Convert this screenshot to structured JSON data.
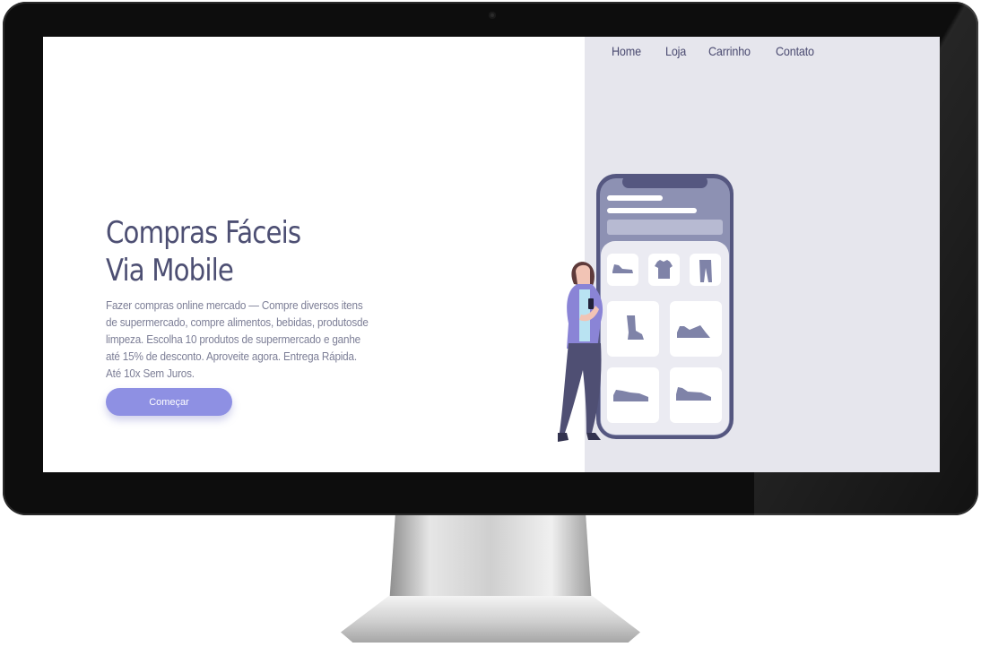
{
  "nav": {
    "items": [
      {
        "label": "Home"
      },
      {
        "label": "Loja"
      },
      {
        "label": "Carrinho"
      },
      {
        "label": "Contato"
      }
    ]
  },
  "hero": {
    "title_line1": "Compras Fáceis",
    "title_line2": "Via Mobile",
    "description": "Fazer compras online mercado — Compre diversos itens de supermercado, compre alimentos, bebidas, produtosde limpeza. Escolha 10 produtos de supermercado e ganhe até 15% de desconto. Aproveite agora. Entrega Rápida. Até 10x Sem Juros.",
    "cta_label": "Começar"
  },
  "colors": {
    "accent": "#8e90e3",
    "heading": "#4d4f73",
    "body_text": "#7c7e96",
    "panel_bg": "#e6e6ed",
    "phone_frame": "#555780"
  },
  "icons": [
    "monitor-bezel",
    "woman-holding-phone",
    "smartphone",
    "shoe-icon",
    "tshirt-icon",
    "pants-icon",
    "boot-icon",
    "sneaker-icon"
  ]
}
